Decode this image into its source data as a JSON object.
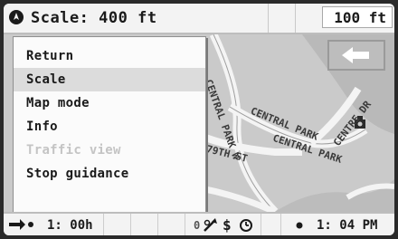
{
  "topbar": {
    "compass_icon": "compass-icon",
    "scale_label": "Scale: 400 ft",
    "scale_value": "100 ft"
  },
  "map": {
    "labels": [
      "CENTRAL PARK W",
      "CENTRAL PARK",
      "CENTRAL PARK",
      "CENTRE DR",
      "79TH ST"
    ],
    "back_icon": "arrow-left-icon",
    "poi_icon": "camera-icon"
  },
  "menu": {
    "items": [
      {
        "label": "Return",
        "state": "normal"
      },
      {
        "label": "Scale",
        "state": "selected"
      },
      {
        "label": "Map mode",
        "state": "normal"
      },
      {
        "label": "Info",
        "state": "normal"
      },
      {
        "label": "Traffic view",
        "state": "disabled"
      },
      {
        "label": "Stop guidance",
        "state": "normal"
      }
    ]
  },
  "bottombar": {
    "route_icon": "route-arrow-icon",
    "time_remaining": "1: 00h",
    "traffic_count": "0",
    "status_icons": [
      "signal-icon",
      "dollar-icon",
      "clock-icon"
    ],
    "dot_icon": "status-dot-icon",
    "clock": "1: 04 PM"
  }
}
